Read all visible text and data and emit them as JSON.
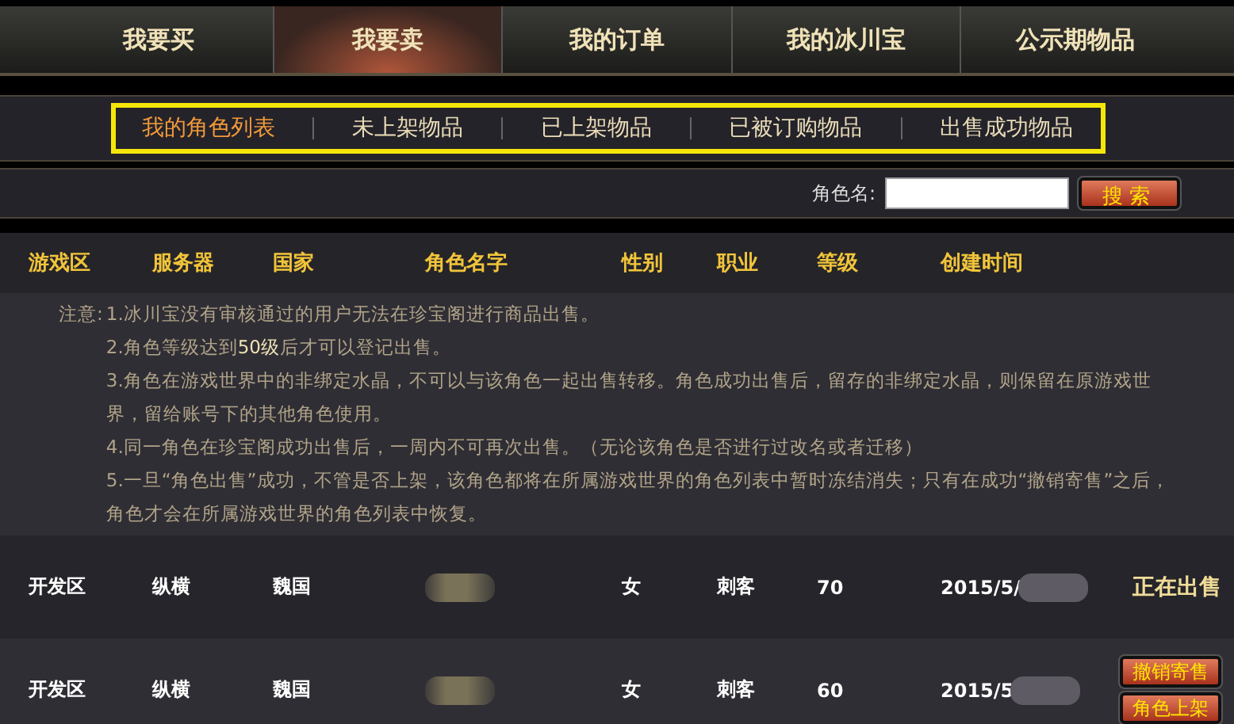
{
  "main_tabs": [
    {
      "label": "我要买",
      "selected": false
    },
    {
      "label": "我要卖",
      "selected": true
    },
    {
      "label": "我的订单",
      "selected": false
    },
    {
      "label": "我的冰川宝",
      "selected": false
    },
    {
      "label": "公示期物品",
      "selected": false
    }
  ],
  "sub_tabs": [
    {
      "label": "我的角色列表",
      "selected": true
    },
    {
      "label": "未上架物品",
      "selected": false
    },
    {
      "label": "已上架物品",
      "selected": false
    },
    {
      "label": "已被订购物品",
      "selected": false
    },
    {
      "label": "出售成功物品",
      "selected": false
    }
  ],
  "search": {
    "label": "角色名:",
    "button": "搜索"
  },
  "table": {
    "columns": [
      "游戏区",
      "服务器",
      "国家",
      "角色名字",
      "性别",
      "职业",
      "等级",
      "创建时间"
    ],
    "notice_label": "注意:",
    "notices": [
      "1.冰川宝没有审核通过的用户无法在珍宝阁进行商品出售。",
      "2.角色等级达到**50级**后才可以登记出售。",
      "3.角色在游戏世界中的非绑定水晶，不可以与该角色一起出售转移。角色成功出售后，留存的非绑定水晶，则保留在原游戏世界，留给账号下的其他角色使用。",
      "4.同一角色在珍宝阁成功出售后，一周内不可再次出售。（无论该角色是否进行过改名或者迁移）",
      "5.一旦“角色出售”成功，不管是否上架，该角色都将在所属游戏世界的角色列表中暂时冻结消失；只有在成功“撤销寄售”之后，角色才会在所属游戏世界的角色列表中恢复。"
    ],
    "rows": [
      {
        "zone": "开发区",
        "server": "纵横",
        "country": "魏国",
        "gender": "女",
        "class": "刺客",
        "level": "70",
        "created": "2015/5/",
        "status": "正在出售"
      },
      {
        "zone": "开发区",
        "server": "纵横",
        "country": "魏国",
        "gender": "女",
        "class": "刺客",
        "level": "60",
        "created": "2015/5",
        "actions": [
          "撤销寄售",
          "角色上架"
        ]
      }
    ]
  }
}
